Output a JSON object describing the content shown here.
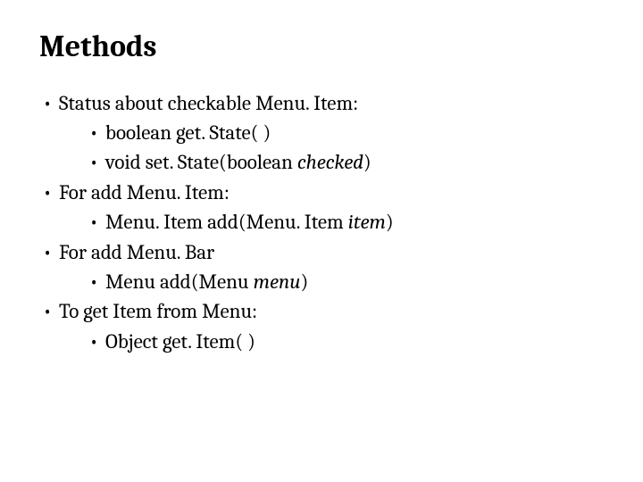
{
  "title": "Methods",
  "bullets": {
    "b1": "Status about checkable Menu. Item:",
    "b1a": "boolean get. State( )",
    "b1b_prefix": "void set. State(boolean ",
    "b1b_italic": "checked",
    "b1b_suffix": ")",
    "b2": "For add Menu. Item:",
    "b2a_prefix": "Menu. Item add(Menu. Item ",
    "b2a_italic": "item",
    "b2a_suffix": ")",
    "b3": "For add Menu. Bar",
    "b3a_prefix": "Menu add(Menu ",
    "b3a_italic": "menu",
    "b3a_suffix": ")",
    "b4": "To get Item from Menu:",
    "b4a": "Object get. Item( )"
  }
}
